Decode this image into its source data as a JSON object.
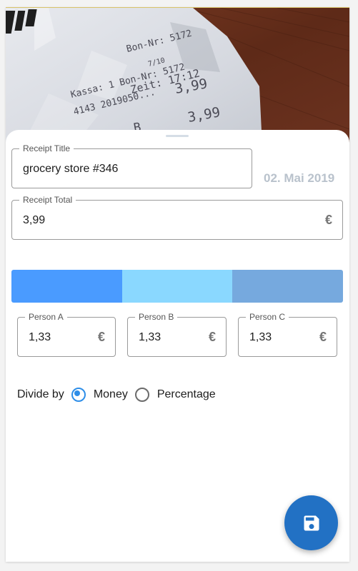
{
  "receipt": {
    "title_label": "Receipt Title",
    "title_value": "grocery store #346",
    "date": "02. Mai 2019",
    "total_label": "Receipt Total",
    "total_value": "3,99",
    "currency": "€"
  },
  "split_bar": {
    "segments": [
      {
        "name": "Person A",
        "share": 0.3333,
        "color": "#4a9bff"
      },
      {
        "name": "Person B",
        "share": 0.3333,
        "color": "#8ad8ff"
      },
      {
        "name": "Person C",
        "share": 0.3334,
        "color": "#76a9de"
      }
    ]
  },
  "persons": [
    {
      "label": "Person A",
      "value": "1,33",
      "currency": "€"
    },
    {
      "label": "Person B",
      "value": "1,33",
      "currency": "€"
    },
    {
      "label": "Person C",
      "value": "1,33",
      "currency": "€"
    }
  ],
  "divide": {
    "label": "Divide by",
    "options": [
      {
        "label": "Money",
        "selected": true
      },
      {
        "label": "Percentage",
        "selected": false
      }
    ]
  },
  "fab": {
    "icon": "save-icon",
    "color": "#2271c4"
  }
}
